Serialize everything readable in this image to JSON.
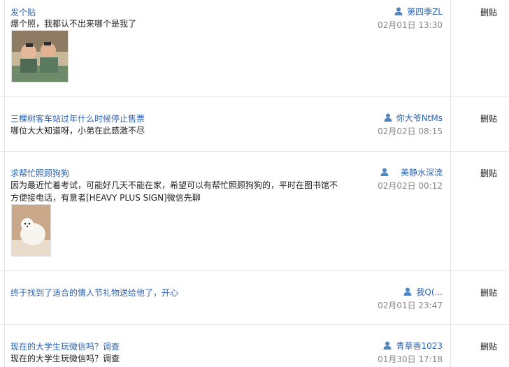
{
  "delete_label": "删贴",
  "posts": [
    {
      "title": "发个贴",
      "content": "爆个照，我都认不出来哪个是我了",
      "author": "第四季ZL",
      "time": "02月01日 13:30"
    },
    {
      "title": "三棵树客车站过年什么时候停止售票",
      "content": "哪位大大知道呀，小弟在此感激不尽",
      "author": "你大爷NtMs",
      "time": "02月02日 08:15"
    },
    {
      "title": "求帮忙照顾狗狗",
      "content": "因为最近忙着考试，可能好几天不能在家，希望可以有帮忙照顾狗狗的，平时在图书馆不方便接电话，有意者[HEAVY PLUS SIGN]微信先聊",
      "author": "美静水深流",
      "time": "02月02日 00:12"
    },
    {
      "title": "终于找到了适合的情人节礼物送给他了，开心",
      "content": "",
      "author": "我Q(...",
      "time": "02月01日 23:47"
    },
    {
      "title": "现在的大学生玩微信吗？调查",
      "content": "现在的大学生玩微信吗？调查",
      "author": "青草香1023",
      "time": "01月30日 17:18"
    }
  ]
}
